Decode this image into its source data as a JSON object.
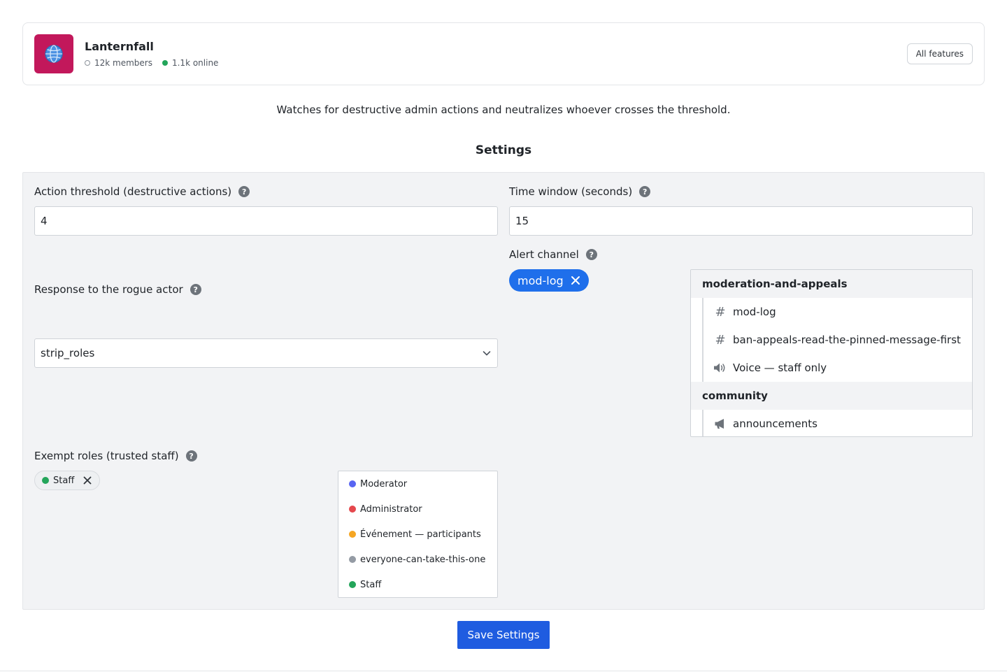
{
  "server": {
    "name": "Lanternfall",
    "icon": "globe-icon",
    "icon_bg": "#c2185b",
    "members": "12k members",
    "online": "1.1k online",
    "all_features_label": "All features"
  },
  "description": "Watches for destructive admin actions and neutralizes whoever crosses the threshold.",
  "settings": {
    "title": "Settings",
    "help_glyph": "?",
    "action_threshold": {
      "label": "Action threshold (destructive actions)",
      "value": "4"
    },
    "time_window": {
      "label": "Time window (seconds)",
      "value": "15"
    },
    "response": {
      "label": "Response to the rogue actor",
      "value": "strip_roles"
    },
    "alert_channel": {
      "label": "Alert channel",
      "selected": "mod-log",
      "chip_color": "#1f6feb",
      "categories": [
        {
          "name": "moderation-and-appeals",
          "channels": [
            {
              "name": "mod-log",
              "type": "text",
              "icon": "hash-icon"
            },
            {
              "name": "ban-appeals-read-the-pinned-message-first",
              "type": "text",
              "icon": "hash-icon"
            },
            {
              "name": "Voice — staff only",
              "type": "voice",
              "icon": "speaker-icon"
            }
          ]
        },
        {
          "name": "community",
          "channels": [
            {
              "name": "announcements",
              "type": "announcement",
              "icon": "megaphone-icon"
            }
          ]
        }
      ]
    },
    "exempt_roles": {
      "label": "Exempt roles (trusted staff)",
      "selected": [
        {
          "name": "Staff",
          "color": "#23a55a"
        }
      ],
      "options": [
        {
          "name": "Moderator",
          "color": "#5865f2"
        },
        {
          "name": "Administrator",
          "color": "#e5484d"
        },
        {
          "name": "Événement — participants",
          "color": "#f5a623"
        },
        {
          "name": "everyone-can-take-this-one",
          "color": "#949ba4"
        },
        {
          "name": "Staff",
          "color": "#23a55a"
        }
      ]
    },
    "save_label": "Save Settings"
  }
}
